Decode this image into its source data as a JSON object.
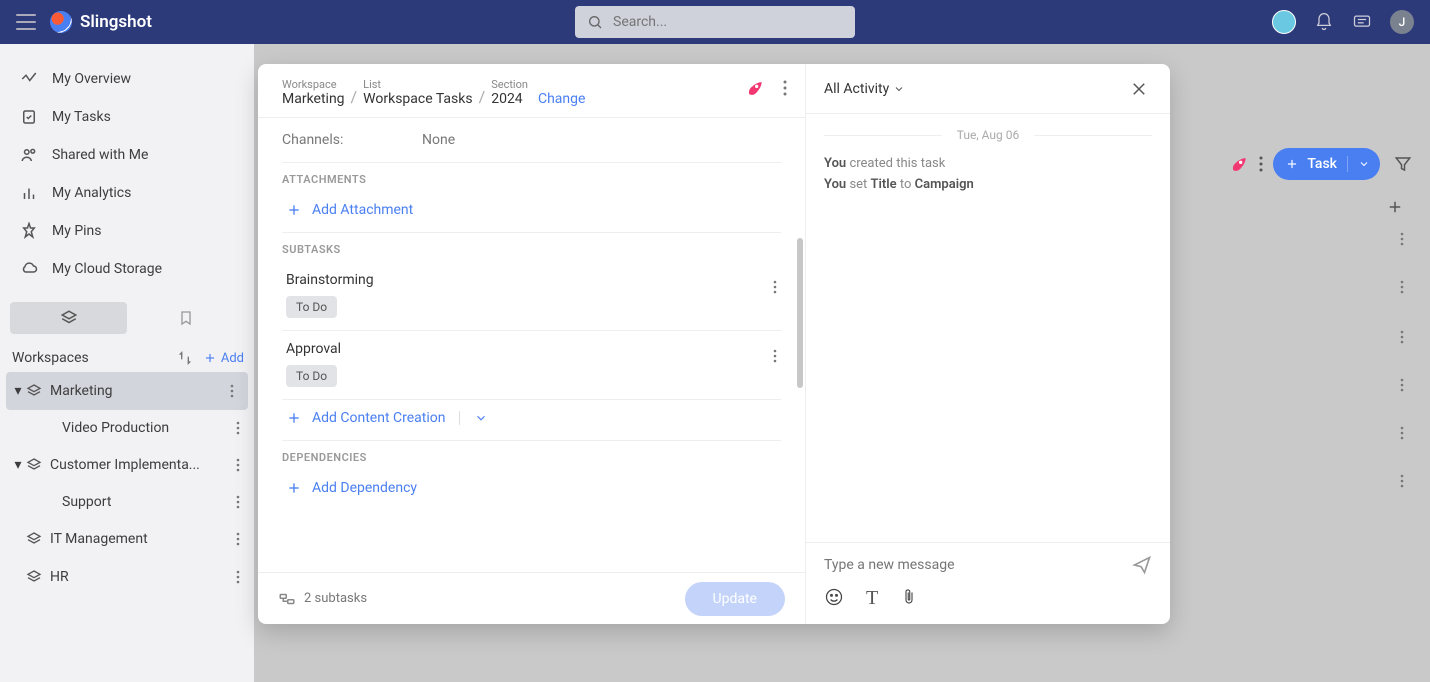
{
  "brand": "Slingshot",
  "search_placeholder": "Search...",
  "user_initial": "J",
  "nav": [
    {
      "label": "My Overview"
    },
    {
      "label": "My Tasks"
    },
    {
      "label": "Shared with Me"
    },
    {
      "label": "My Analytics"
    },
    {
      "label": "My Pins"
    },
    {
      "label": "My Cloud Storage"
    }
  ],
  "workspaces_header": "Workspaces",
  "add_label": "Add",
  "workspaces": [
    {
      "name": "Marketing",
      "selected": true,
      "expanded": true,
      "children": [
        "Video Production"
      ]
    },
    {
      "name": "Customer Implementa...",
      "expanded": true,
      "children": [
        "Support"
      ]
    },
    {
      "name": "IT Management"
    },
    {
      "name": "HR"
    }
  ],
  "toolbar": {
    "task_label": "Task"
  },
  "bg_row_dots_tops": [
    232,
    280,
    330,
    378,
    426,
    474
  ],
  "modal": {
    "breadcrumb": {
      "workspace_label": "Workspace",
      "workspace": "Marketing",
      "list_label": "List",
      "list": "Workspace Tasks",
      "section_label": "Section",
      "section": "2024",
      "change": "Change"
    },
    "channels_label": "Channels:",
    "channels_value": "None",
    "attachments_heading": "ATTACHMENTS",
    "add_attachment": "Add Attachment",
    "subtasks_heading": "SUBTASKS",
    "subtasks": [
      {
        "title": "Brainstorming",
        "status": "To Do"
      },
      {
        "title": "Approval",
        "status": "To Do"
      }
    ],
    "add_subtask": "Add Content Creation",
    "dependencies_heading": "DEPENDENCIES",
    "add_dependency": "Add Dependency",
    "footer_subtasks": "2 subtasks",
    "update_label": "Update"
  },
  "activity": {
    "dropdown": "All Activity",
    "date": "Tue, Aug 06",
    "line1_who": "You",
    "line1_rest": "created this task",
    "line2_who": "You",
    "line2_a": "set",
    "line2_b": "Title",
    "line2_c": "to",
    "line2_d": "Campaign",
    "msg_placeholder": "Type a new message"
  }
}
